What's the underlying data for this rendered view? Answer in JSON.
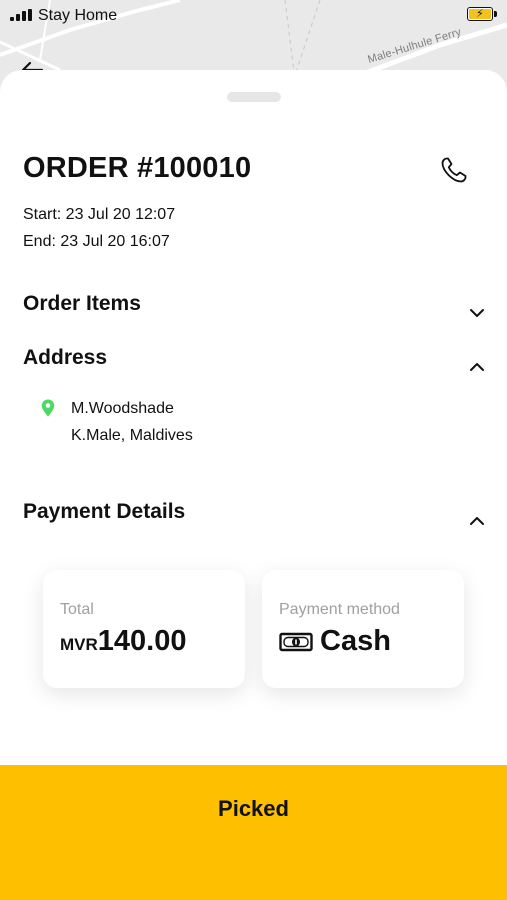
{
  "status_bar": {
    "carrier": "Stay Home",
    "signal_icon": "signal-bars-icon",
    "battery_icon": "battery-charging-icon",
    "battery_color": "#f4c21d"
  },
  "map": {
    "road_label": "Male-Hulhule Ferry",
    "background_color": "#e9e9e9"
  },
  "nav": {
    "back_icon": "arrow-left-icon"
  },
  "order": {
    "title": "ORDER #100010",
    "phone_icon": "phone-icon",
    "start": "Start: 23 Jul 20 12:07",
    "end": "End: 23 Jul 20 16:07"
  },
  "sections": {
    "order_items": {
      "title": "Order Items",
      "state": "collapsed"
    },
    "address": {
      "title": "Address",
      "state": "expanded",
      "pin_color": "#4cd964",
      "line1": "M.Woodshade",
      "line2": "K.Male, Maldives"
    },
    "payment": {
      "title": "Payment Details",
      "state": "expanded",
      "total_label": "Total",
      "currency": "MVR",
      "amount": "140.00",
      "method_label": "Payment method",
      "method_icon": "cash-icon",
      "method_value": "Cash"
    }
  },
  "action": {
    "label": "Picked",
    "color": "#fdbf00"
  }
}
